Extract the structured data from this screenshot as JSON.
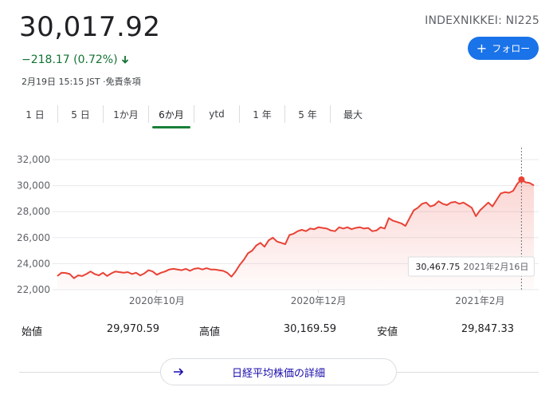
{
  "quote": {
    "price": "30,017.92",
    "change": "−218.17 (0.72%)",
    "timestamp": "2月19日 15:15 JST ·免責条項",
    "ticker": "INDEXNIKKEI: NI225",
    "follow_label": "フォロー"
  },
  "tabs": [
    {
      "label": "1 日"
    },
    {
      "label": "5 日"
    },
    {
      "label": "1か月"
    },
    {
      "label": "6か月",
      "active": true
    },
    {
      "label": "ytd"
    },
    {
      "label": "1 年"
    },
    {
      "label": "5 年"
    },
    {
      "label": "最大"
    }
  ],
  "stats": [
    {
      "label": "始値",
      "value": "29,970.59"
    },
    {
      "label": "高値",
      "value": "30,169.59"
    },
    {
      "label": "安値",
      "value": "29,847.33"
    }
  ],
  "details_label": "日経平均株価の詳細",
  "colors": {
    "line": "#e94235",
    "down": "#137333",
    "accent": "#1a73e8"
  },
  "chart_data": {
    "type": "area",
    "title": "",
    "ylim": [
      22000,
      32000
    ],
    "yticks": [
      "32,000",
      "30,000",
      "28,000",
      "26,000",
      "24,000",
      "22,000"
    ],
    "ytick_values": [
      32000,
      30000,
      28000,
      26000,
      24000,
      22000
    ],
    "xticks": [
      {
        "label": "2020年10月",
        "index": 24
      },
      {
        "label": "2020年12月",
        "index": 63
      },
      {
        "label": "2021年2月",
        "index": 102
      }
    ],
    "grid": true,
    "tooltip": {
      "value": "30,467.75",
      "date": "2021年2月16日",
      "index": 112
    },
    "values": [
      23050,
      23300,
      23280,
      23200,
      22880,
      23100,
      23050,
      23200,
      23400,
      23200,
      23100,
      23300,
      23050,
      23250,
      23400,
      23350,
      23300,
      23350,
      23200,
      23300,
      23100,
      23250,
      23500,
      23400,
      23150,
      23300,
      23400,
      23550,
      23600,
      23550,
      23500,
      23600,
      23450,
      23600,
      23650,
      23550,
      23650,
      23550,
      23550,
      23500,
      23450,
      23300,
      23000,
      23400,
      23900,
      24300,
      24800,
      25000,
      25400,
      25600,
      25300,
      25800,
      26000,
      25700,
      25600,
      25500,
      26200,
      26300,
      26500,
      26600,
      26500,
      26700,
      26650,
      26800,
      26750,
      26700,
      26550,
      26500,
      26800,
      26700,
      26800,
      26650,
      26750,
      26800,
      26700,
      26750,
      26500,
      26550,
      26800,
      26700,
      27500,
      27300,
      27200,
      27100,
      26900,
      27500,
      28100,
      28300,
      28600,
      28700,
      28400,
      28500,
      28800,
      28600,
      28500,
      28700,
      28750,
      28600,
      28700,
      28500,
      28300,
      27650,
      28100,
      28400,
      28700,
      28400,
      28900,
      29400,
      29500,
      29450,
      29600,
      30150,
      30470,
      30250,
      30200,
      30010
    ]
  }
}
